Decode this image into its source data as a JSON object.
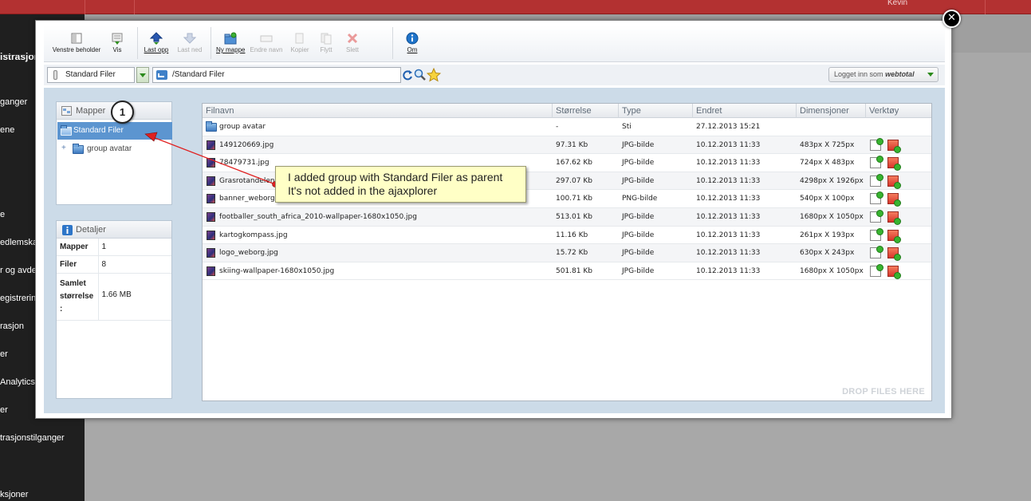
{
  "background": {
    "sidebar_title": "istrasjon",
    "sidebar_items": [
      "ganger",
      "ene",
      "e",
      "edlemska",
      "r og avde",
      "egistrering",
      "rasjon",
      "er",
      "Analytics",
      "er",
      "trasjonstilganger",
      "ksjoner"
    ],
    "topbar_right_text": "Kevin"
  },
  "toolbar": {
    "buttons": [
      {
        "label": "Venstre beholder",
        "icon": "panel-icon",
        "enabled": true
      },
      {
        "label": "Vis",
        "icon": "view-icon",
        "enabled": true
      },
      {
        "label": "Last opp",
        "icon": "upload-icon",
        "enabled": true
      },
      {
        "label": "Last ned",
        "icon": "download-icon",
        "enabled": false
      },
      {
        "label": "Ny mappe",
        "icon": "new-folder-icon",
        "enabled": true
      },
      {
        "label": "Endre navn",
        "icon": "rename-icon",
        "enabled": false
      },
      {
        "label": "Kopier",
        "icon": "copy-icon",
        "enabled": false
      },
      {
        "label": "Flytt",
        "icon": "move-icon",
        "enabled": false
      },
      {
        "label": "Slett",
        "icon": "delete-icon",
        "enabled": false
      },
      {
        "label": "Om",
        "icon": "info-icon",
        "enabled": true
      }
    ]
  },
  "location": {
    "repository": "Standard Filer",
    "path": "/Standard Filer",
    "login_prefix": "Logget inn som",
    "login_user": "webtotal"
  },
  "folders_panel": {
    "title": "Mapper",
    "selected": "Standard Filer",
    "children": [
      "group avatar"
    ]
  },
  "details_panel": {
    "title": "Detaljer",
    "rows": [
      {
        "key": "Mapper",
        "value": "1"
      },
      {
        "key": "Filer",
        "value": "8"
      },
      {
        "key": "Samlet størrelse :",
        "value": "1.66 MB"
      }
    ]
  },
  "file_list": {
    "columns": [
      "Filnavn",
      "Størrelse",
      "Type",
      "Endret",
      "Dimensjoner",
      "Verktøy"
    ],
    "rows": [
      {
        "name": "group avatar",
        "size": "-",
        "type": "Sti",
        "modified": "27.12.2013 15:21",
        "dimensions": "",
        "kind": "folder"
      },
      {
        "name": "149120669.jpg",
        "size": "97.31 Kb",
        "type": "JPG-bilde",
        "modified": "10.12.2013 11:33",
        "dimensions": "483px X 725px",
        "kind": "file"
      },
      {
        "name": "78479731.jpg",
        "size": "167.62 Kb",
        "type": "JPG-bilde",
        "modified": "10.12.2013 11:33",
        "dimensions": "724px X 483px",
        "kind": "file"
      },
      {
        "name": "Grasrotandelen",
        "size": "297.07 Kb",
        "type": "JPG-bilde",
        "modified": "10.12.2013 11:33",
        "dimensions": "4298px X 1926px",
        "kind": "file"
      },
      {
        "name": "banner_weborg",
        "size": "100.71 Kb",
        "type": "PNG-bilde",
        "modified": "10.12.2013 11:33",
        "dimensions": "540px X 100px",
        "kind": "file"
      },
      {
        "name": "footballer_south_africa_2010-wallpaper-1680x1050.jpg",
        "size": "513.01 Kb",
        "type": "JPG-bilde",
        "modified": "10.12.2013 11:33",
        "dimensions": "1680px X 1050px",
        "kind": "file"
      },
      {
        "name": "kartogkompass.jpg",
        "size": "11.16 Kb",
        "type": "JPG-bilde",
        "modified": "10.12.2013 11:33",
        "dimensions": "261px X 193px",
        "kind": "file"
      },
      {
        "name": "logo_weborg.jpg",
        "size": "15.72 Kb",
        "type": "JPG-bilde",
        "modified": "10.12.2013 11:33",
        "dimensions": "630px X 243px",
        "kind": "file"
      },
      {
        "name": "skiing-wallpaper-1680x1050.jpg",
        "size": "501.81 Kb",
        "type": "JPG-bilde",
        "modified": "10.12.2013 11:33",
        "dimensions": "1680px X 1050px",
        "kind": "file"
      }
    ],
    "drop_hint": "DROP FILES HERE"
  },
  "annotation": {
    "number": "1",
    "note_line1": "I added group with Standard Filer as parent",
    "note_line2": "It's not added in the ajaxplorer"
  },
  "colors": {
    "topbar": "#b33131",
    "selection": "#5c95d0",
    "note_bg": "#ffffc6",
    "arrow": "#e02020"
  }
}
